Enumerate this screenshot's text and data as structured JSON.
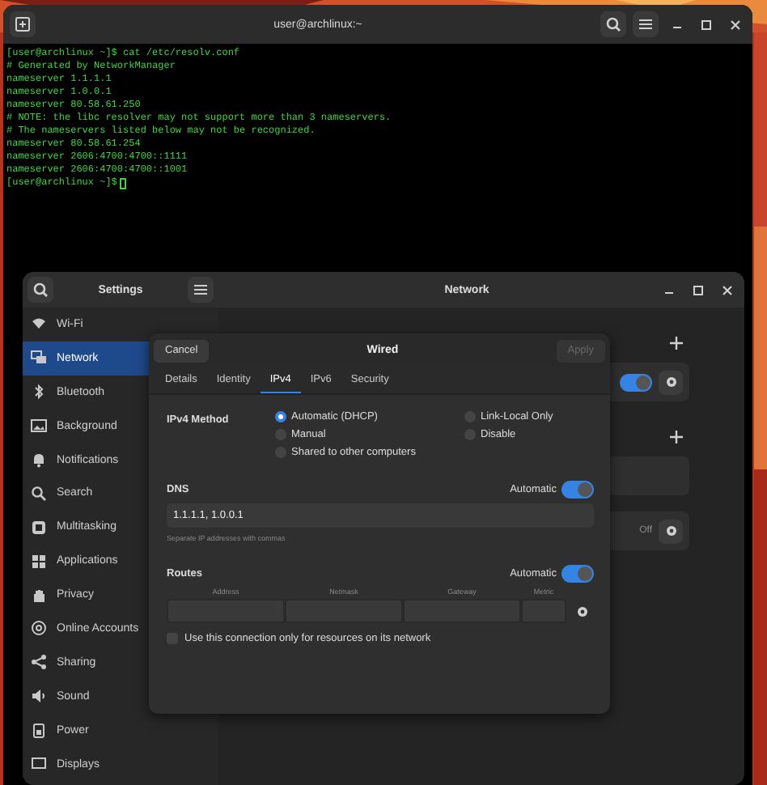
{
  "terminal": {
    "title": "user@archlinux:~",
    "lines": [
      "[user@archlinux ~]$ cat /etc/resolv.conf",
      "# Generated by NetworkManager",
      "nameserver 1.1.1.1",
      "nameserver 1.0.0.1",
      "nameserver 80.58.61.250",
      "# NOTE: the libc resolver may not support more than 3 nameservers.",
      "# The nameservers listed below may not be recognized.",
      "nameserver 80.58.61.254",
      "nameserver 2606:4700:4700::1111",
      "nameserver 2606:4700:4700::1001"
    ],
    "prompt": "[user@archlinux ~]$"
  },
  "settings": {
    "title": "Settings",
    "page_title": "Network",
    "sidebar": [
      {
        "label": "Wi-Fi",
        "selected": false
      },
      {
        "label": "Network",
        "selected": true
      },
      {
        "label": "Bluetooth",
        "selected": false
      },
      {
        "label": "Background",
        "selected": false
      },
      {
        "label": "Notifications",
        "selected": false
      },
      {
        "label": "Search",
        "selected": false
      },
      {
        "label": "Multitasking",
        "selected": false
      },
      {
        "label": "Applications",
        "selected": false
      },
      {
        "label": "Privacy",
        "selected": false
      },
      {
        "label": "Online Accounts",
        "selected": false
      },
      {
        "label": "Sharing",
        "selected": false
      },
      {
        "label": "Sound",
        "selected": false
      },
      {
        "label": "Power",
        "selected": false
      },
      {
        "label": "Displays",
        "selected": false
      }
    ],
    "sections": [
      {
        "rows": [
          {
            "kind": "switch",
            "on": true
          }
        ]
      },
      {
        "rows": [
          {
            "kind": "empty"
          },
          {
            "kind": "status",
            "status": "Off"
          }
        ]
      }
    ]
  },
  "dialog": {
    "title": "Wired",
    "cancel": "Cancel",
    "apply": {
      "label": "Apply",
      "disabled": true
    },
    "tabs": [
      {
        "label": "Details",
        "selected": false
      },
      {
        "label": "Identity",
        "selected": false
      },
      {
        "label": "IPv4",
        "selected": true
      },
      {
        "label": "IPv6",
        "selected": false
      },
      {
        "label": "Security",
        "selected": false
      }
    ],
    "method": {
      "label": "IPv4 Method",
      "options": [
        {
          "label": "Automatic (DHCP)",
          "selected": true
        },
        {
          "label": "Link-Local Only",
          "selected": false
        },
        {
          "label": "Manual",
          "selected": false
        },
        {
          "label": "Disable",
          "selected": false
        },
        {
          "label": "Shared to other computers",
          "selected": false
        }
      ]
    },
    "dns": {
      "label": "DNS",
      "automatic_label": "Automatic",
      "automatic": true,
      "value": "1.1.1.1, 1.0.0.1",
      "hint": "Separate IP addresses with commas"
    },
    "routes": {
      "label": "Routes",
      "automatic_label": "Automatic",
      "automatic": true,
      "columns": [
        "Address",
        "Netmask",
        "Gateway",
        "Metric"
      ]
    },
    "restrict": {
      "label": "Use this connection only for resources on its network",
      "checked": false
    }
  }
}
